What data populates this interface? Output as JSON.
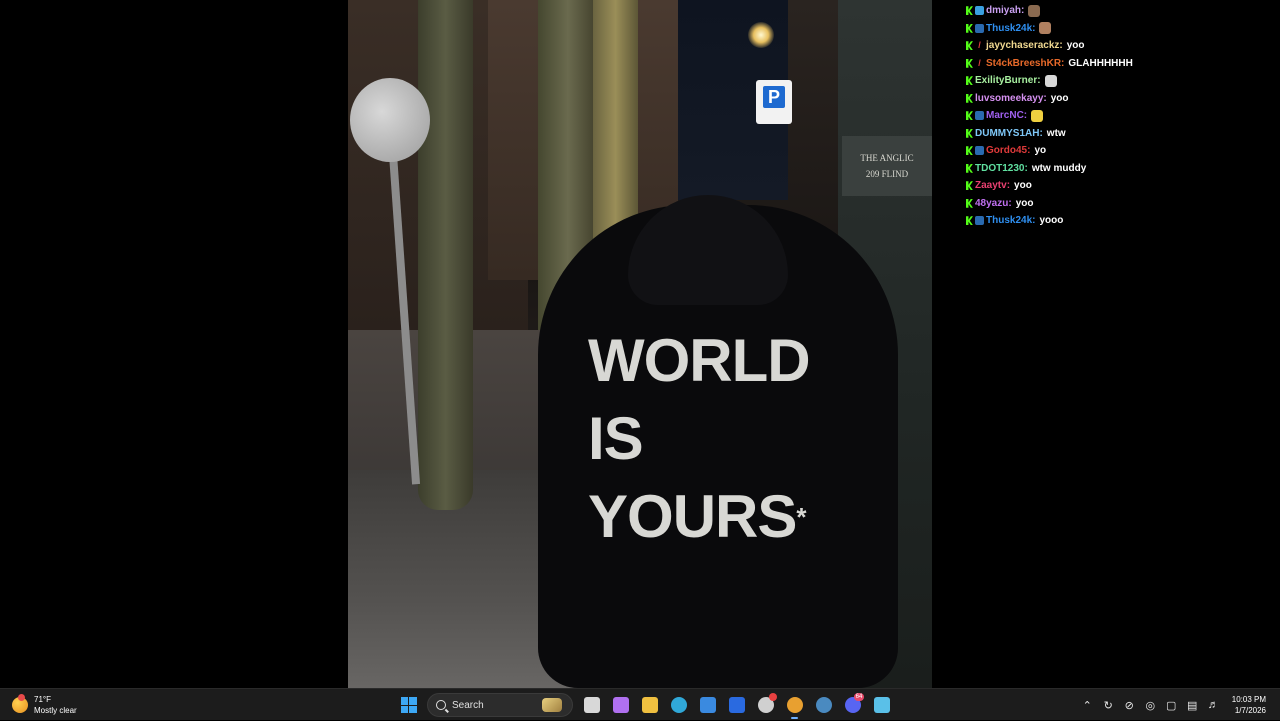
{
  "photo": {
    "hoodie_print_line1": "WORLD",
    "hoodie_print_line2": "IS",
    "hoodie_print_line3": "YOURS",
    "hoodie_print_mark": "*",
    "parking_sign": "P",
    "plaque_line1": "THE ANGLIC",
    "plaque_line2": "209 FLIND"
  },
  "chat": {
    "messages": [
      {
        "user": "dmiyah",
        "color": "#c9a0f0",
        "text": "",
        "badges": [
          "kick",
          "blue"
        ],
        "emote": "#8a6a50"
      },
      {
        "user": "Thusk24k",
        "color": "#2f8ff0",
        "text": "",
        "badges": [
          "kick",
          "boxed"
        ],
        "emote": "#b08060"
      },
      {
        "user": "jayychaserackz",
        "color": "#f0d890",
        "text": "yoo",
        "badges": [
          "kick",
          "red"
        ]
      },
      {
        "user": "St4ckBreeshKR",
        "color": "#e86a2a",
        "text": "GLAHHHHHH",
        "badges": [
          "kick",
          "red"
        ]
      },
      {
        "user": "ExilityBurner",
        "color": "#a8f0a0",
        "text": "",
        "badges": [
          "kick"
        ],
        "emote": "#d8d8d8"
      },
      {
        "user": "luvsomeekayy",
        "color": "#d590f0",
        "text": "yoo",
        "badges": [
          "kick"
        ]
      },
      {
        "user": "MarcNC",
        "color": "#a060f0",
        "text": "",
        "badges": [
          "kick",
          "boxed"
        ],
        "emote": "#f0d040"
      },
      {
        "user": "DUMMYS1AH",
        "color": "#7fc8f8",
        "text": "wtw",
        "badges": [
          "kick"
        ]
      },
      {
        "user": "Gordo45",
        "color": "#e03a3a",
        "text": "yo",
        "badges": [
          "kick",
          "boxed"
        ]
      },
      {
        "user": "TDOT1230",
        "color": "#60e0a0",
        "text": "wtw muddy",
        "badges": [
          "kick"
        ]
      },
      {
        "user": "Zaaytv",
        "color": "#e84070",
        "text": "yoo",
        "badges": [
          "kick"
        ]
      },
      {
        "user": "48yazu",
        "color": "#c070f0",
        "text": "yoo",
        "badges": [
          "kick"
        ]
      },
      {
        "user": "Thusk24k",
        "color": "#2f8ff0",
        "text": "yooo",
        "badges": [
          "kick",
          "boxed"
        ]
      }
    ],
    "separator": ":"
  },
  "taskbar": {
    "weather_temp": "71°F",
    "weather_desc": "Mostly clear",
    "search_label": "Search",
    "apps": [
      {
        "name": "task-view",
        "color": "#d8d8d8"
      },
      {
        "name": "copilot",
        "color": "#b070f0"
      },
      {
        "name": "file-explorer",
        "color": "#f0c040"
      },
      {
        "name": "edge",
        "color": "#30a8d8"
      },
      {
        "name": "microsoft-store",
        "color": "#3a8ae0"
      },
      {
        "name": "mail",
        "color": "#2a6ae0"
      },
      {
        "name": "game-app",
        "color": "#d0d0d0"
      },
      {
        "name": "chrome",
        "color": "#e8a030"
      },
      {
        "name": "steam",
        "color": "#4a8ac0"
      },
      {
        "name": "discord",
        "color": "#5865f2"
      },
      {
        "name": "notepad",
        "color": "#5ac0e8"
      }
    ],
    "discord_badge": "64",
    "clock_time": "10:03 PM",
    "clock_date": "1/7/2026"
  }
}
